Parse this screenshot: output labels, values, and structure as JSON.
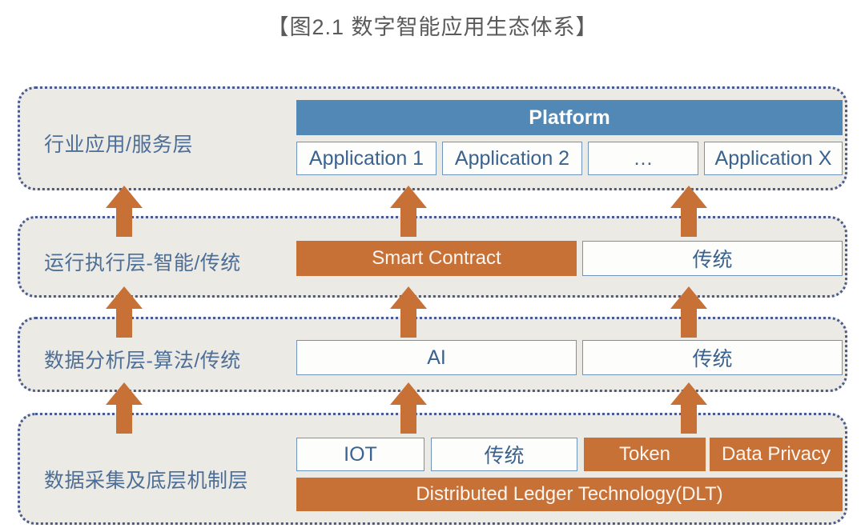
{
  "title": "【图2.1 数字智能应用生态体系】",
  "colors": {
    "blue_fill": "#5288b5",
    "orange_fill": "#c87137",
    "panel_bg": "#eceae5",
    "panel_border": "#4a5a8f",
    "label_text": "#4d6e96",
    "outline_border": "#6e94bd"
  },
  "layers": {
    "application": {
      "label": "行业应用/服务层",
      "platform": "Platform",
      "apps": [
        "Application 1",
        "Application 2",
        "…",
        "Application X"
      ]
    },
    "execution": {
      "label": "运行执行层-智能/传统",
      "smart": "Smart Contract",
      "legacy": "传统"
    },
    "analysis": {
      "label": "数据分析层-算法/传统",
      "ai": "AI",
      "legacy": "传统"
    },
    "data": {
      "label": "数据采集及底层机制层",
      "iot": "IOT",
      "legacy": "传统",
      "token": "Token",
      "privacy": "Data Privacy",
      "dlt": "Distributed Ledger Technology(DLT)"
    }
  },
  "arrows": {
    "direction": "up",
    "count": 9,
    "columns": 3,
    "rows": 3
  }
}
